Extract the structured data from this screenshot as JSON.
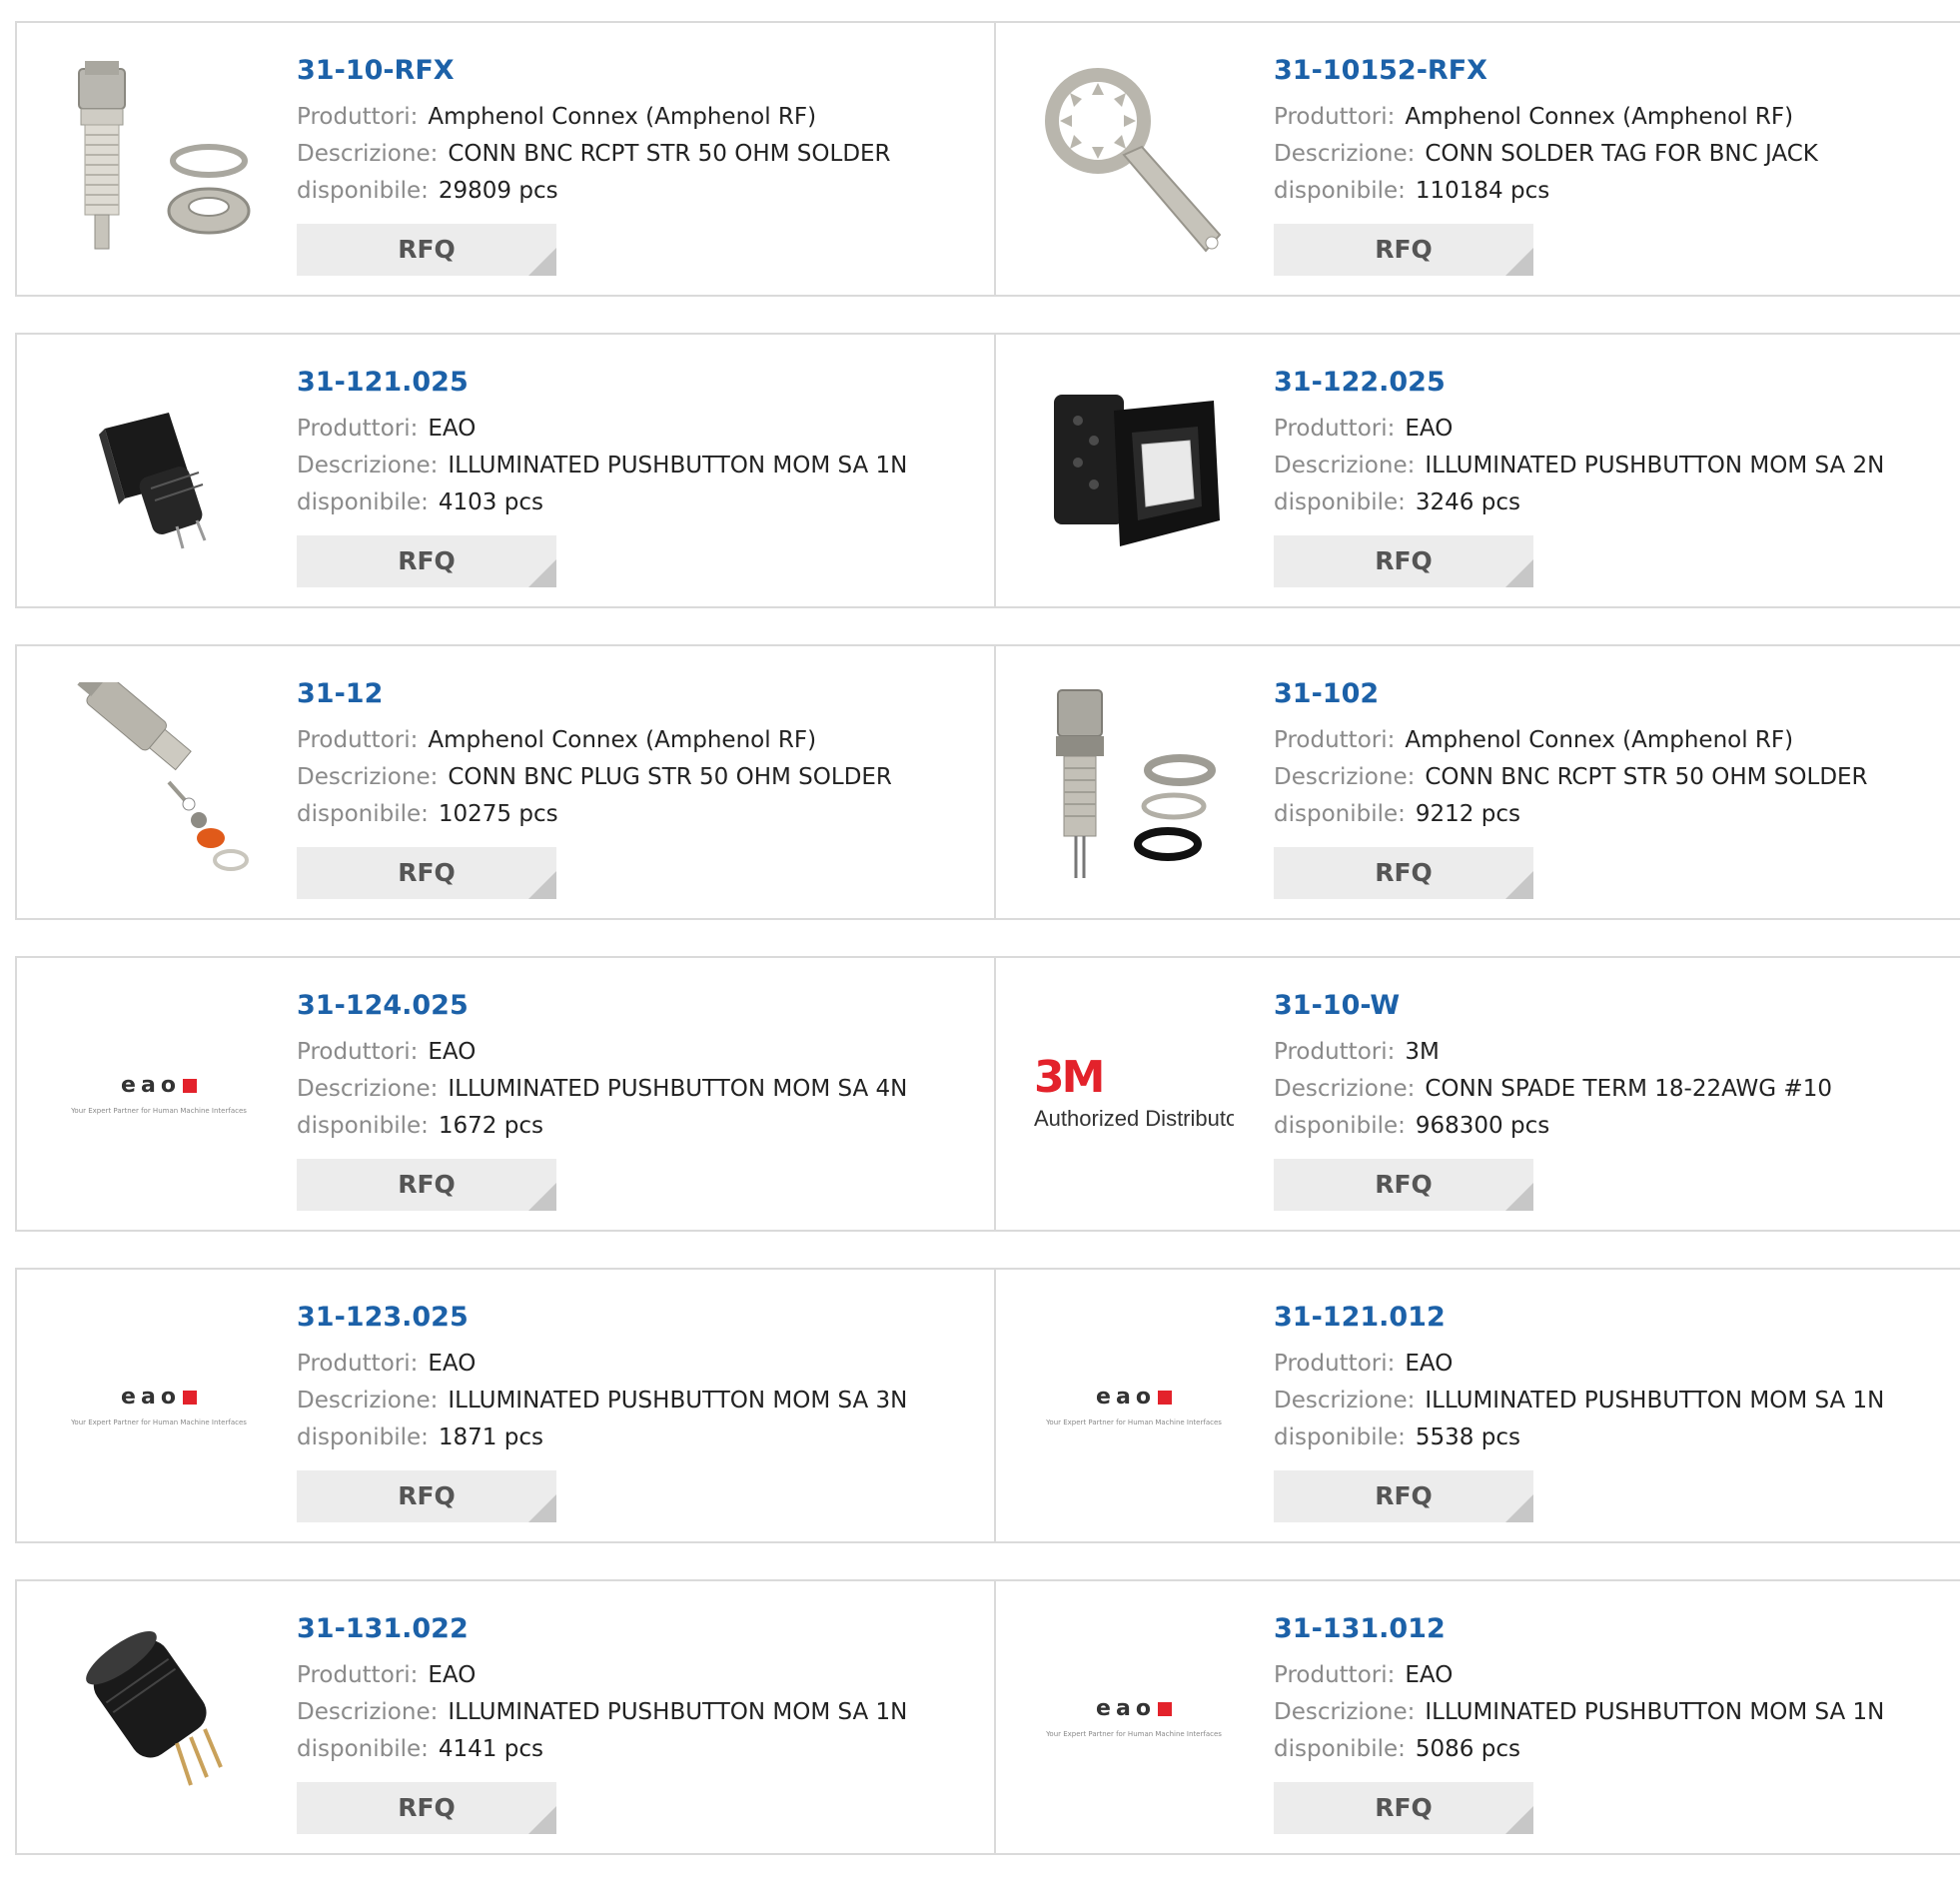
{
  "labels": {
    "manufacturer": "Produttori:",
    "description": "Descrizione:",
    "available": "disponibile:",
    "rfq": "RFQ"
  },
  "products": [
    {
      "part": "31-10-RFX",
      "manufacturer": "Amphenol Connex (Amphenol RF)",
      "description": "CONN BNC RCPT STR 50 OHM SOLDER",
      "available": "29809 pcs",
      "image": "bnc-receptacle-icon"
    },
    {
      "part": "31-10152-RFX",
      "manufacturer": "Amphenol Connex (Amphenol RF)",
      "description": "CONN SOLDER TAG FOR BNC JACK",
      "available": "110184 pcs",
      "image": "solder-tag-icon"
    },
    {
      "part": "31-121.025",
      "manufacturer": "EAO",
      "description": "ILLUMINATED PUSHBUTTON MOM SA 1N",
      "available": "4103 pcs",
      "image": "pushbutton-icon"
    },
    {
      "part": "31-122.025",
      "manufacturer": "EAO",
      "description": "ILLUMINATED PUSHBUTTON MOM SA 2N",
      "available": "3246 pcs",
      "image": "pushbutton-square-icon"
    },
    {
      "part": "31-12",
      "manufacturer": "Amphenol Connex (Amphenol RF)",
      "description": "CONN BNC PLUG STR 50 OHM SOLDER",
      "available": "10275 pcs",
      "image": "bnc-plug-icon"
    },
    {
      "part": "31-102",
      "manufacturer": "Amphenol Connex (Amphenol RF)",
      "description": "CONN BNC RCPT STR 50 OHM SOLDER",
      "available": "9212 pcs",
      "image": "bnc-receptacle-icon"
    },
    {
      "part": "31-124.025",
      "manufacturer": "EAO",
      "description": "ILLUMINATED PUSHBUTTON MOM SA 4N",
      "available": "1672 pcs",
      "image": "eao-logo"
    },
    {
      "part": "31-10-W",
      "manufacturer": "3M",
      "description": "CONN SPADE TERM 18-22AWG #10",
      "available": "968300 pcs",
      "image": "3m-logo"
    },
    {
      "part": "31-123.025",
      "manufacturer": "EAO",
      "description": "ILLUMINATED PUSHBUTTON MOM SA 3N",
      "available": "1871 pcs",
      "image": "eao-logo"
    },
    {
      "part": "31-121.012",
      "manufacturer": "EAO",
      "description": "ILLUMINATED PUSHBUTTON MOM SA 1N",
      "available": "5538 pcs",
      "image": "eao-logo"
    },
    {
      "part": "31-131.022",
      "manufacturer": "EAO",
      "description": "ILLUMINATED PUSHBUTTON MOM SA 1N",
      "available": "4141 pcs",
      "image": "round-pushbutton-icon"
    },
    {
      "part": "31-131.012",
      "manufacturer": "EAO",
      "description": "ILLUMINATED PUSHBUTTON MOM SA 1N",
      "available": "5086 pcs",
      "image": "eao-logo"
    }
  ],
  "logos": {
    "eao_word": "eao",
    "eao_tagline": "Your Expert Partner for Human Machine Interfaces",
    "m3_mark": "3M",
    "m3_sub": "Authorized Distributor"
  },
  "colors": {
    "part_link": "#1c61a8",
    "label": "#8a8a8a",
    "value": "#222222",
    "rfq_bg": "#ececec",
    "brand_red": "#e3222b"
  }
}
